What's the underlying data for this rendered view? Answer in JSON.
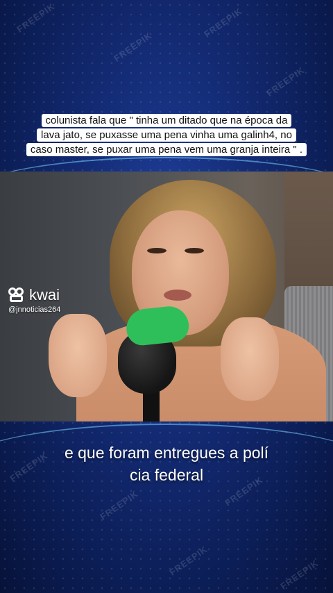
{
  "caption": {
    "line1": "colunista fala que \" tinha um ditado que na época da",
    "line2": "lava jato, se puxasse uma pena vinha uma galinh4, no",
    "line3": "caso master, se puxar uma pena vem uma granja inteira \" ."
  },
  "video": {
    "microphone_color": "#2fbf5a"
  },
  "kwai": {
    "brand": "kwai",
    "handle": "@jnnoticias264"
  },
  "subtitle": {
    "line1": "e que foram entregues a polí",
    "line2": "cia federal"
  },
  "watermarks": {
    "text": "FREEPIK"
  }
}
